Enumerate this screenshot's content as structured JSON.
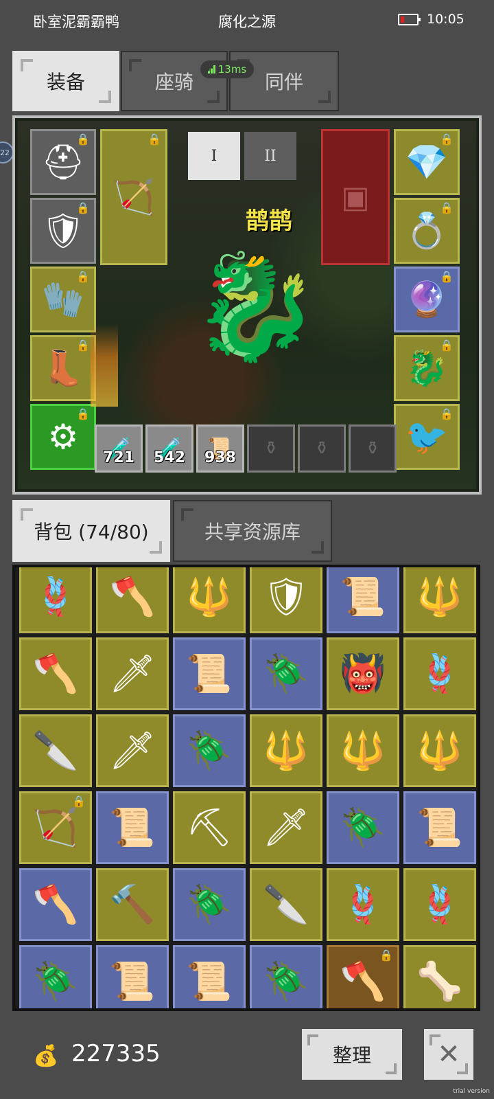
{
  "status": {
    "left": "卧室泥霸霸鸭",
    "center": "腐化之源",
    "time": "10:05"
  },
  "top_tabs": [
    {
      "label": "装备"
    },
    {
      "label": "座骑"
    },
    {
      "label": "同伴"
    }
  ],
  "ping": "13ms",
  "side_badge": "22",
  "page_buttons": [
    "I",
    "II"
  ],
  "character": {
    "name": "鹊鹊"
  },
  "equip_left": [
    {
      "icon": "helmet-icon",
      "glyph": "⛑"
    },
    {
      "icon": "armor-icon",
      "glyph": "🛡"
    },
    {
      "icon": "gauntlet-icon",
      "glyph": "🧤"
    },
    {
      "icon": "boots-icon",
      "glyph": "👢"
    },
    {
      "icon": "gear-icon",
      "glyph": "⚙"
    }
  ],
  "equip_weapon": {
    "icon": "crossbow-icon",
    "glyph": "🏹"
  },
  "equip_right": [
    {
      "icon": "amulet-icon",
      "glyph": "💎"
    },
    {
      "icon": "ring-icon",
      "glyph": "💍"
    },
    {
      "icon": "purple-ring-icon",
      "glyph": "🔮"
    },
    {
      "icon": "dragon-mount-icon",
      "glyph": "🐉"
    },
    {
      "icon": "magpie-pet-icon",
      "glyph": "🐦"
    }
  ],
  "consumables": [
    {
      "icon": "blue-potion-icon",
      "glyph": "🧪",
      "qty": "721"
    },
    {
      "icon": "blue-potion-icon",
      "glyph": "🧪",
      "qty": "542"
    },
    {
      "icon": "scroll-icon",
      "glyph": "📜",
      "qty": "938"
    }
  ],
  "bag_tabs": [
    {
      "label": "背包 (74/80)"
    },
    {
      "label": "共享资源库"
    }
  ],
  "bag_items": [
    {
      "icon": "coil-icon",
      "glyph": "🪢",
      "color": "olive"
    },
    {
      "icon": "axe-icon",
      "glyph": "🪓",
      "color": "olive"
    },
    {
      "icon": "trident-icon",
      "glyph": "🔱",
      "color": "olive"
    },
    {
      "icon": "chestplate-icon",
      "glyph": "🛡",
      "color": "olive"
    },
    {
      "icon": "scroll-card-icon",
      "glyph": "📜",
      "color": "blue"
    },
    {
      "icon": "trident-icon",
      "glyph": "🔱",
      "color": "olive"
    },
    {
      "icon": "axe-icon",
      "glyph": "🪓",
      "color": "olive"
    },
    {
      "icon": "dagger-icon",
      "glyph": "🗡",
      "color": "olive"
    },
    {
      "icon": "scroll-card-icon",
      "glyph": "📜",
      "color": "blue"
    },
    {
      "icon": "scarab-icon",
      "glyph": "🪲",
      "color": "blue"
    },
    {
      "icon": "horned-helm-icon",
      "glyph": "👹",
      "color": "olive"
    },
    {
      "icon": "coil-icon",
      "glyph": "🪢",
      "color": "olive"
    },
    {
      "icon": "knife-icon",
      "glyph": "🔪",
      "color": "olive"
    },
    {
      "icon": "sword-icon",
      "glyph": "🗡",
      "color": "olive"
    },
    {
      "icon": "scarab-icon",
      "glyph": "🪲",
      "color": "blue"
    },
    {
      "icon": "spear-icon",
      "glyph": "🔱",
      "color": "olive"
    },
    {
      "icon": "spear-icon",
      "glyph": "🔱",
      "color": "olive"
    },
    {
      "icon": "spear-icon",
      "glyph": "🔱",
      "color": "olive"
    },
    {
      "icon": "bow-icon",
      "glyph": "🏹",
      "color": "olive",
      "locked": true
    },
    {
      "icon": "scroll-card-icon",
      "glyph": "📜",
      "color": "blue"
    },
    {
      "icon": "pickaxe-icon",
      "glyph": "⛏",
      "color": "olive"
    },
    {
      "icon": "sword-icon",
      "glyph": "🗡",
      "color": "olive"
    },
    {
      "icon": "scarab-icon",
      "glyph": "🪲",
      "color": "blue"
    },
    {
      "icon": "scroll-card-icon",
      "glyph": "📜",
      "color": "blue"
    },
    {
      "icon": "battle-axe-icon",
      "glyph": "🪓",
      "color": "blue"
    },
    {
      "icon": "mace-icon",
      "glyph": "🔨",
      "color": "olive"
    },
    {
      "icon": "scarab-icon",
      "glyph": "🪲",
      "color": "blue"
    },
    {
      "icon": "knife-icon",
      "glyph": "🔪",
      "color": "olive"
    },
    {
      "icon": "coil-icon",
      "glyph": "🪢",
      "color": "olive"
    },
    {
      "icon": "coil-icon",
      "glyph": "🪢",
      "color": "olive"
    },
    {
      "icon": "scarab-icon",
      "glyph": "🪲",
      "color": "blue"
    },
    {
      "icon": "scroll-card-icon",
      "glyph": "📜",
      "color": "blue"
    },
    {
      "icon": "scroll-card-icon",
      "glyph": "📜",
      "color": "blue"
    },
    {
      "icon": "scarab-icon",
      "glyph": "🪲",
      "color": "blue"
    },
    {
      "icon": "red-axe-icon",
      "glyph": "🪓",
      "color": "brown",
      "locked": true
    },
    {
      "icon": "bone-armor-icon",
      "glyph": "🦴",
      "color": "olive"
    }
  ],
  "gold": "227335",
  "sort_button": "整理",
  "close_button": "✕",
  "watermark": "trial version"
}
